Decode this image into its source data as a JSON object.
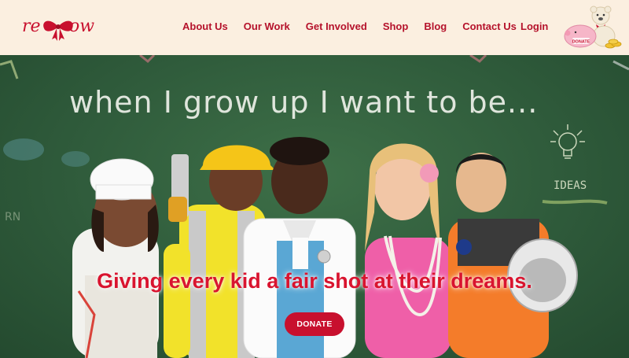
{
  "brand": {
    "logo_text": "re**ow",
    "logo_alt": "redbow logo"
  },
  "nav": {
    "items": [
      {
        "label": "About Us"
      },
      {
        "label": "Our Work"
      },
      {
        "label": "Get Involved"
      },
      {
        "label": "Shop"
      },
      {
        "label": "Blog"
      },
      {
        "label": "Contact Us"
      }
    ],
    "login_label": "Login",
    "donate_graphic_label": "DONATE"
  },
  "hero": {
    "chalk_headline": "when I grow up I want to be...",
    "chalk_ideas": "IDEAS",
    "tagline": "Giving every kid a fair shot at their dreams.",
    "donate_button": "DONATE"
  },
  "colors": {
    "brand_red": "#c8102e",
    "header_bg": "#fbefe0",
    "chalkboard": "#2f5a3a"
  }
}
